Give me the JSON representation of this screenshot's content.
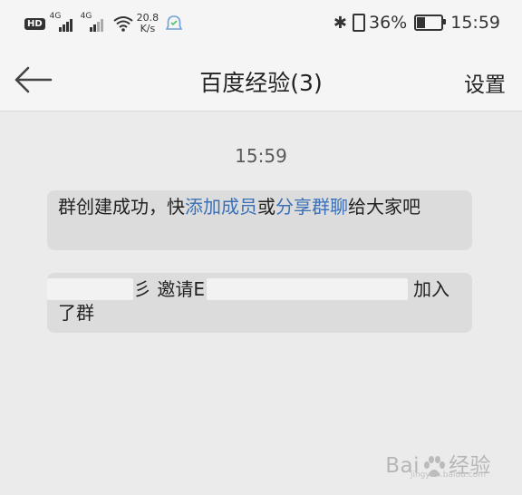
{
  "status_bar": {
    "hd_badge": "HD",
    "sim1_label": "4G",
    "sim2_label": "4G",
    "net_speed_value": "20.8",
    "net_speed_unit": "K/s",
    "battery_percent": "36%",
    "battery_level": 0.36,
    "clock": "15:59"
  },
  "header": {
    "title": "百度经验(3)",
    "settings_label": "设置"
  },
  "chat": {
    "timestamp": "15:59",
    "msg1": {
      "p1": "群创建成功，快",
      "link1": "添加成员",
      "p2": "或",
      "link2": "分享群聊",
      "p3": "给大家吧"
    },
    "msg2": {
      "p1": "彡 邀请E",
      "p2": "加入了群"
    }
  },
  "watermark": {
    "text_left": "Bai",
    "text_right": "经验",
    "subtext": "jingyan.baidu.com"
  }
}
